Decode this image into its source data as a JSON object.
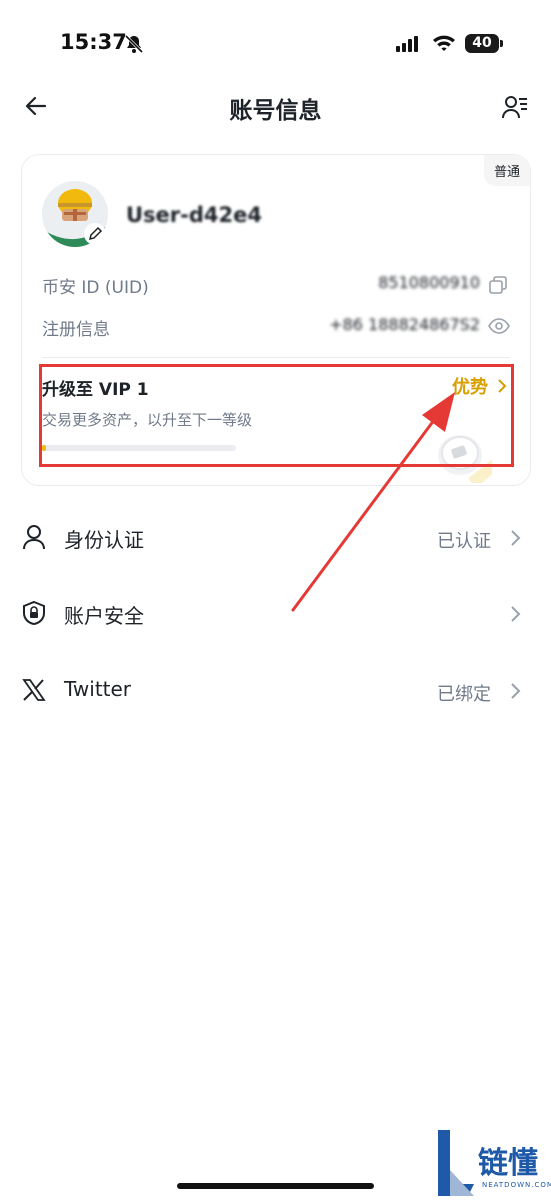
{
  "status_bar": {
    "time": "15:37",
    "battery": "40"
  },
  "header": {
    "title": "账号信息"
  },
  "card": {
    "tier_badge": "普通",
    "username": "User-d42e4",
    "uid_label": "币安 ID (UID)",
    "uid_value": "8510800910",
    "reg_label": "注册信息",
    "reg_value": "+86 188824867S2",
    "vip_title": "升级至 VIP 1",
    "vip_advantage": "优势",
    "vip_subtitle": "交易更多资产，以升至下一等级",
    "vip_progress": 0.02
  },
  "menu": [
    {
      "label": "身份认证",
      "status": "已认证",
      "icon": "person-icon"
    },
    {
      "label": "账户安全",
      "status": "",
      "icon": "shield-lock-icon"
    },
    {
      "label": "Twitter",
      "status": "已绑定",
      "icon": "x-logo-icon"
    }
  ],
  "watermark": {
    "text": "链懂",
    "sub": "NEATDOWN.COM"
  },
  "colors": {
    "accent": "#f0b90b",
    "advantage": "#d89f00",
    "annotation": "#e53935"
  }
}
